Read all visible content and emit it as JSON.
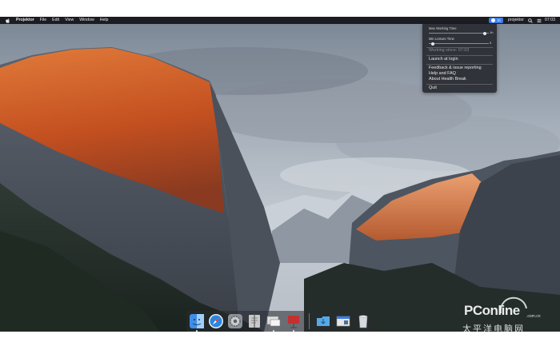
{
  "menubar": {
    "app_name": "Projektor",
    "menus": [
      "File",
      "Edit",
      "View",
      "Window",
      "Help"
    ],
    "status_badge": "1h",
    "status_app": "projektor",
    "clock": "07:03"
  },
  "health_menu": {
    "max_working_label": "Max Working Time",
    "max_working_value": "1h",
    "min_leisure_label": "Min Leisure Time",
    "min_leisure_value": "5",
    "max_working_fraction": 0.96,
    "min_leisure_fraction": 0.04,
    "working_since": "Working since: 07:03",
    "items": [
      "Launch at login",
      "Feedback & issue reporting",
      "Help and FAQ",
      "About Health Break",
      "Quit"
    ]
  },
  "dock": {
    "icons": [
      {
        "name": "finder-icon",
        "color": "#3f8ee8"
      },
      {
        "name": "safari-icon",
        "color": "#2a86e0"
      },
      {
        "name": "system-preferences-icon",
        "color": "#8e9196"
      },
      {
        "name": "script-editor-icon",
        "color": "#c9c9c9"
      },
      {
        "name": "projektor-icon",
        "color": "#e0e0e0"
      },
      {
        "name": "presentation-icon",
        "color": "#c43030"
      },
      {
        "name": "downloads-folder-icon",
        "color": "#58a8e6"
      },
      {
        "name": "screenshot-icon",
        "color": "#e6e6e6"
      },
      {
        "name": "trash-icon",
        "color": "#d6d9dd"
      }
    ]
  },
  "watermark": {
    "brand": "PConline",
    "domain": ".com.cn",
    "chinese": "太平洋电脑网"
  },
  "colors": {
    "menubar_bg": "#1b1d22",
    "accent_blue": "#3e7be8",
    "rock_orange": "#d4602a"
  }
}
